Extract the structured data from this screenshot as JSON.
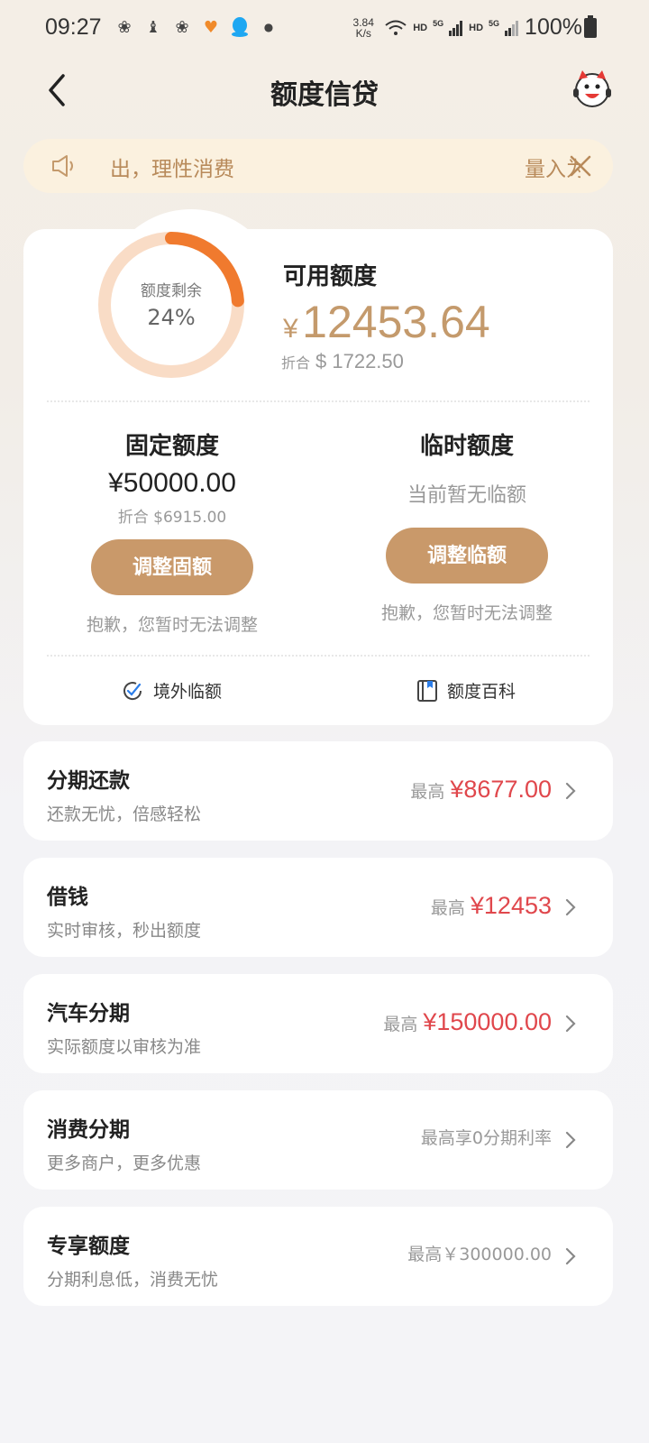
{
  "status_bar": {
    "time": "09:27",
    "net_speed": "3.84",
    "net_unit": "K/s",
    "hd1": "HD",
    "g1": "5G",
    "hd2": "HD",
    "g2": "5G",
    "battery": "100%"
  },
  "header": {
    "title": "额度信贷"
  },
  "notice": {
    "text": "出，理性消费",
    "text_tail": "量入为"
  },
  "credit": {
    "ring_label": "额度剩余",
    "remaining_pct_text": "24%",
    "remaining_fraction": 0.24,
    "available_label": "可用额度",
    "available_currency": "¥",
    "available_amount": "12453.64",
    "fx_label": "折合",
    "fx_value": "$ 1722.50",
    "fixed": {
      "title": "固定额度",
      "amount": "¥50000.00",
      "fx": "折合 $6915.00",
      "button": "调整固额",
      "note": "抱歉，您暂时无法调整"
    },
    "temp": {
      "title": "临时额度",
      "status": "当前暂无临额",
      "button": "调整临额",
      "note": "抱歉，您暂时无法调整"
    },
    "links": {
      "overseas": "境外临额",
      "wiki": "额度百科"
    }
  },
  "products": [
    {
      "title": "分期还款",
      "subtitle": "还款无忧，倍感轻松",
      "prefix": "最高",
      "amount": "¥8677.00"
    },
    {
      "title": "借钱",
      "subtitle": "实时审核，秒出额度",
      "prefix": "最高",
      "amount": "¥12453"
    },
    {
      "title": "汽车分期",
      "subtitle": "实际额度以审核为准",
      "prefix": "最高",
      "amount": "¥150000.00"
    },
    {
      "title": "消费分期",
      "subtitle": "更多商户，更多优惠",
      "plain": "最高享0分期利率"
    },
    {
      "title": "专享额度",
      "subtitle": "分期利息低，消费无忧",
      "plain": "最高￥300000.00"
    }
  ],
  "colors": {
    "accent_gold": "#c49a6c",
    "button_gold": "#c9996a",
    "ring_orange": "#f07a2e",
    "ring_track": "#f9dcc6",
    "amount_red": "#e0474c",
    "notice_bg": "#fbf1df"
  }
}
